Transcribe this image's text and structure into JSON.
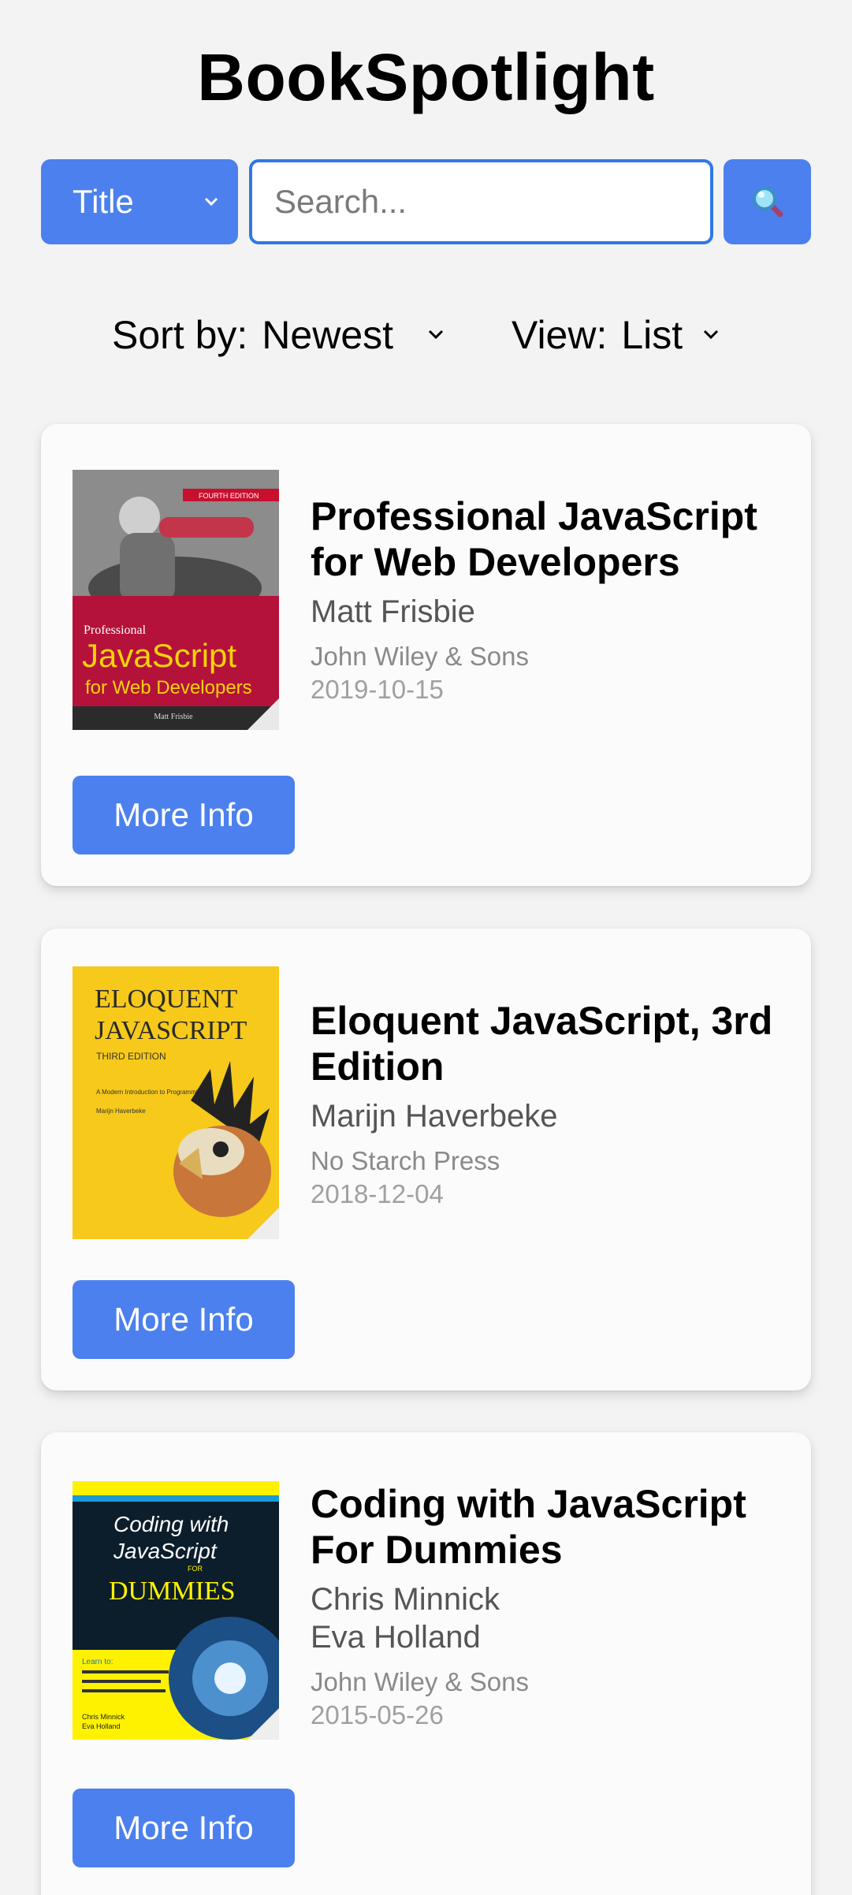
{
  "app": {
    "title": "BookSpotlight"
  },
  "search": {
    "field_select_value": "Title",
    "placeholder": "Search...",
    "value": "",
    "search_icon": "magnifier-icon"
  },
  "controls": {
    "sort_label": "Sort by:",
    "sort_value": "Newest",
    "view_label": "View:",
    "view_value": "List"
  },
  "books": [
    {
      "title_line1": "Professional JavaScript",
      "title_line2": "for Web Developers",
      "authors": [
        "Matt Frisbie"
      ],
      "publisher": "John Wiley & Sons",
      "date": "2019-10-15",
      "button": "More Info",
      "cover": {
        "edition": "FOURTH EDITION",
        "small": "Professional",
        "big": "JavaScript",
        "sub": "for Web Developers",
        "author": "Matt Frisbie"
      }
    },
    {
      "title_line1": "Eloquent JavaScript, 3rd",
      "title_line2": "Edition",
      "authors": [
        "Marijn Haverbeke"
      ],
      "publisher": "No Starch Press",
      "date": "2018-12-04",
      "button": "More Info",
      "cover": {
        "line1": "ELOQUENT",
        "line2": "JAVASCRIPT",
        "edition": "THIRD EDITION",
        "sub": "A Modern Introduction to Programming",
        "author": "Marijn Haverbeke"
      }
    },
    {
      "title_line1": "Coding with JavaScript",
      "title_line2": "For Dummies",
      "authors": [
        "Chris Minnick",
        "Eva Holland"
      ],
      "publisher": "John Wiley & Sons",
      "date": "2015-05-26",
      "button": "More Info",
      "cover": {
        "line1": "Coding with",
        "line2": "JavaScript",
        "for": "FOR",
        "brand": "DUMMIES",
        "learn": "Learn to:",
        "authors": "Chris Minnick\nEva Holland"
      }
    }
  ],
  "colors": {
    "accent": "#4b80ee",
    "input_border": "#2f78e6",
    "background": "#f3f3f3"
  }
}
